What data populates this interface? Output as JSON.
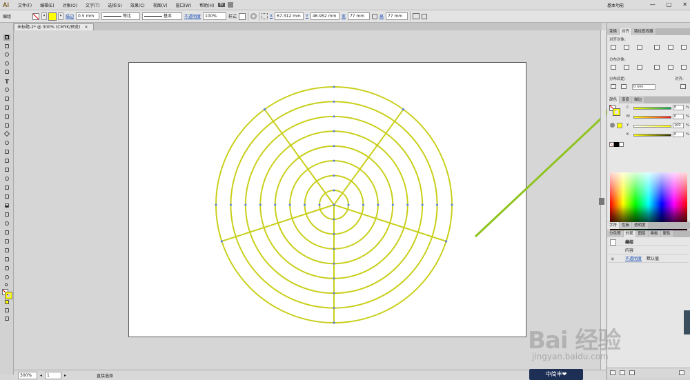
{
  "app": {
    "logo": "Ai",
    "workspace": "基本功能"
  },
  "menu": [
    "文件(F)",
    "编辑(E)",
    "对象(O)",
    "文字(T)",
    "选择(S)",
    "效果(C)",
    "视图(V)",
    "窗口(W)",
    "帮助(H)"
  ],
  "menu_extra": "Br",
  "window_buttons": [
    "—",
    "□",
    "✕"
  ],
  "control": {
    "mode": "编组",
    "stroke_label": "描边",
    "stroke_weight": "0.5 mm",
    "profile": "等比",
    "brush": "基本",
    "opacity_label": "不透明度",
    "opacity": "100%",
    "style_label": "样式",
    "x_label": "X",
    "x": "67.312 mm",
    "y_label": "Y",
    "y": "46.952 mm",
    "w_label": "宽",
    "w": "77 mm",
    "h_label": "高",
    "h": "77 mm"
  },
  "document": {
    "tab": "未标题-2* @ 300% (CMYK/预览)"
  },
  "status": {
    "zoom": "300%",
    "page": "1",
    "tool": "直接选择"
  },
  "panels": {
    "align_tabs": [
      "变换",
      "对齐",
      "路径查找器"
    ],
    "align_objects": "对齐对象:",
    "distribute_objects": "分布对象:",
    "distribute_spacing": "分布间距:",
    "align_to": "对齐:",
    "spacing_value": "0 mm",
    "color_tabs": [
      "颜色",
      "渐变",
      "描边"
    ],
    "cmyk": [
      {
        "label": "C",
        "value": "0",
        "grad_from": "#ffff00",
        "grad_to": "#00a651"
      },
      {
        "label": "M",
        "value": "0",
        "grad_from": "#ffff00",
        "grad_to": "#ed1c24"
      },
      {
        "label": "Y",
        "value": "100",
        "grad_from": "#ffffff",
        "grad_to": "#ffff00"
      },
      {
        "label": "K",
        "value": "0",
        "grad_from": "#ffff00",
        "grad_to": "#333300"
      }
    ],
    "pct": "%",
    "char_tabs": [
      "字符",
      "色板",
      "透明度"
    ],
    "appearance_tabs": [
      "分色预",
      "外观",
      "图层",
      "画板",
      "属性"
    ],
    "appearance_rows": [
      "编组",
      "内容",
      "不透明度",
      "默认值"
    ]
  },
  "colors": {
    "stroke": "#c9cf1a",
    "anchor": "#5b7fd8",
    "arrow": "#8fc31f"
  },
  "watermark": {
    "brand": "Bai 经验",
    "url": "jingyan.baidu.com",
    "badge": "中简丰❤"
  }
}
